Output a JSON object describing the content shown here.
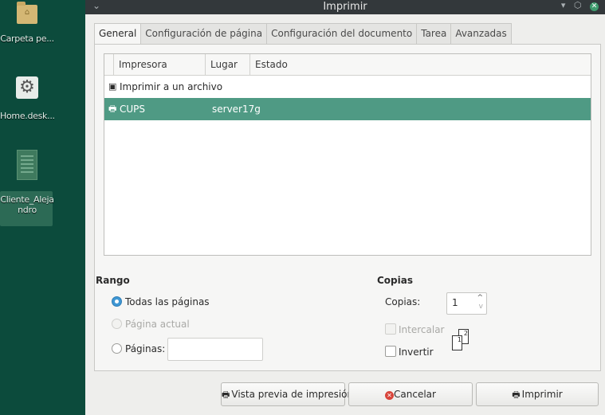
{
  "desktop": {
    "icons": [
      {
        "label": "Carpeta pe...",
        "icon": "folder-icon"
      },
      {
        "label": "Home.desk...",
        "icon": "gear-icon"
      },
      {
        "label": "Cliente_Aleja",
        "label2": "ndro",
        "icon": "document-icon"
      }
    ]
  },
  "window": {
    "title": "Imprimir",
    "controls": {
      "minimize": "▾",
      "maximize": "⬡",
      "close": "✕"
    }
  },
  "tabs": [
    {
      "label": "General",
      "active": true
    },
    {
      "label": "Configuración de página"
    },
    {
      "label": "Configuración del documento"
    },
    {
      "label": "Tarea"
    },
    {
      "label": "Avanzadas"
    }
  ],
  "printer_table": {
    "columns": [
      "Impresora",
      "Lugar",
      "Estado"
    ],
    "rows": [
      {
        "name": "Imprimir a un archivo",
        "location": "",
        "state": "",
        "icon": "file-icon"
      },
      {
        "name": "CUPS",
        "location": "server17g",
        "state": "",
        "icon": "printer-icon",
        "selected": true
      }
    ]
  },
  "range": {
    "title": "Rango",
    "all_pages": "Todas las páginas",
    "current_page": "Página actual",
    "pages": "Páginas:",
    "pages_value": "",
    "selected": "all_pages"
  },
  "copies": {
    "title": "Copias",
    "copies_label": "Copias:",
    "copies_value": "1",
    "collate": "Intercalar",
    "reverse": "Invertir"
  },
  "buttons": {
    "preview": "Vista previa de impresión",
    "cancel": "Cancelar",
    "print": "Imprimir"
  },
  "colors": {
    "selection": "#4f9a84",
    "radio_accent": "#3f97d4",
    "desktop_bg": "#0c4b3c"
  }
}
